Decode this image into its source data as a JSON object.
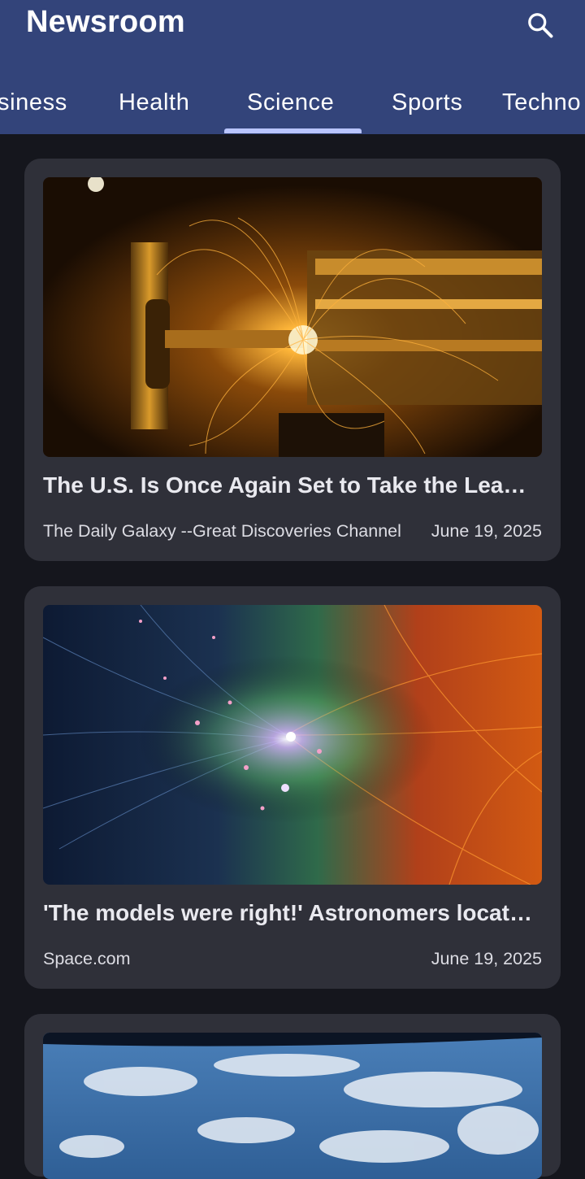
{
  "app_bar": {
    "title": "Newsroom",
    "search_icon": "search-icon"
  },
  "tabs": [
    {
      "label": "Business",
      "visible_text": "siness"
    },
    {
      "label": "Health",
      "visible_text": "Health"
    },
    {
      "label": "Science",
      "visible_text": "Science",
      "selected": true
    },
    {
      "label": "Sports",
      "visible_text": "Sports"
    },
    {
      "label": "Technology",
      "visible_text": "Techno"
    }
  ],
  "articles": [
    {
      "title": "The U.S. Is Once Again Set to Take the Lea…",
      "source": "The Daily Galaxy --Great Discoveries Channel",
      "date": "June 19, 2025",
      "image": "sparks-industrial-photo"
    },
    {
      "title": "'The models were right!' Astronomers locat…",
      "source": "Space.com",
      "date": "June 19, 2025",
      "image": "cosmic-web-photo"
    },
    {
      "title": "",
      "source": "",
      "date": "",
      "image": "earth-from-orbit-photo"
    }
  ],
  "colors": {
    "app_bar": "#33447a",
    "background": "#15161d",
    "card": "#2f3039",
    "tab_indicator": "#b9c5ff"
  }
}
